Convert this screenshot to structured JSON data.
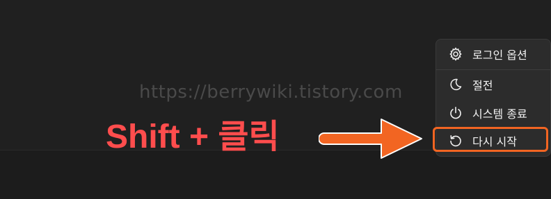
{
  "watermark": "https://berrywiki.tistory.com",
  "power_menu": {
    "items": [
      {
        "label": "로그인 옵션",
        "icon": "gear-icon"
      },
      {
        "label": "절전",
        "icon": "moon-icon"
      },
      {
        "label": "시스템 종료",
        "icon": "power-icon"
      },
      {
        "label": "다시 시작",
        "icon": "restart-icon"
      }
    ]
  },
  "annotation": {
    "text": "Shift + 클릭",
    "color": "#ff4d4d",
    "arrow_color": "#f26522"
  },
  "colors": {
    "background": "#202020",
    "menu_background": "#2c2c2c",
    "highlight": "#f26522"
  }
}
